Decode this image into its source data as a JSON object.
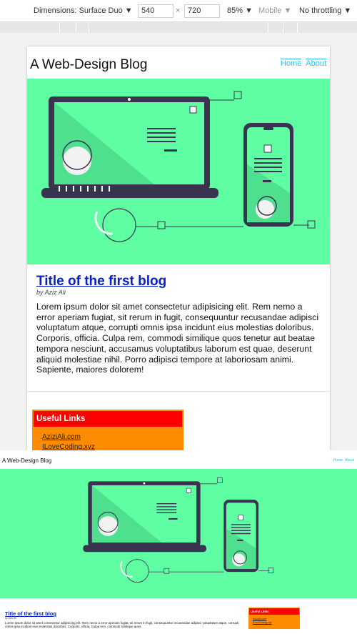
{
  "devtools": {
    "dimensions_label": "Dimensions: Surface Duo ▼",
    "width_value": "540",
    "height_value": "720",
    "times": "×",
    "zoom": "85% ▼",
    "mobile": "Mobile ▼",
    "throttling": "No throttling ▼"
  },
  "site": {
    "title": "A Web-Design Blog",
    "nav": [
      "Home",
      "About"
    ]
  },
  "post": {
    "title": "Title of the first blog",
    "author": "by Aziz Ali",
    "body": "Lorem ipsum dolor sit amet consectetur adipisicing elit. Rem nemo a error aperiam fugiat, sit rerum in fugit, consequuntur recusandae adipisci voluptatum atque, corrupti omnis ipsa incidunt eius molestias doloribus. Corporis, officia. Culpa rem, commodi similique quos tenetur aut beatae tempora nesciunt, accusamus voluptatibus laborum est quae, deserunt aliquid molestiae nihil. Porro adipisci tempore at laboriosam animi. Sapiente, maiores dolorem!",
    "body_full_excerpt": "Lorem ipsum dolor sit amet consectetur adipisicing elit. Rem nemo a error aperiam fugiat, sit rerum in fugit, consequuntur recusandae adipisci voluptatum atque, corrupti omnis ipsa incidunt eius molestias doloribus. Corporis, officia. Culpa rem, commodi similique quos."
  },
  "sidebar": {
    "heading": "Useful Links",
    "links": [
      "AziziAli.com",
      "ILoveCoding.xyz"
    ]
  },
  "colors": {
    "hero_green": "#5ffea2",
    "link_blue": "#0a21c9",
    "nav_cyan": "#2fbde8",
    "links_orange": "#ff8c00",
    "links_red": "#ff0000"
  }
}
